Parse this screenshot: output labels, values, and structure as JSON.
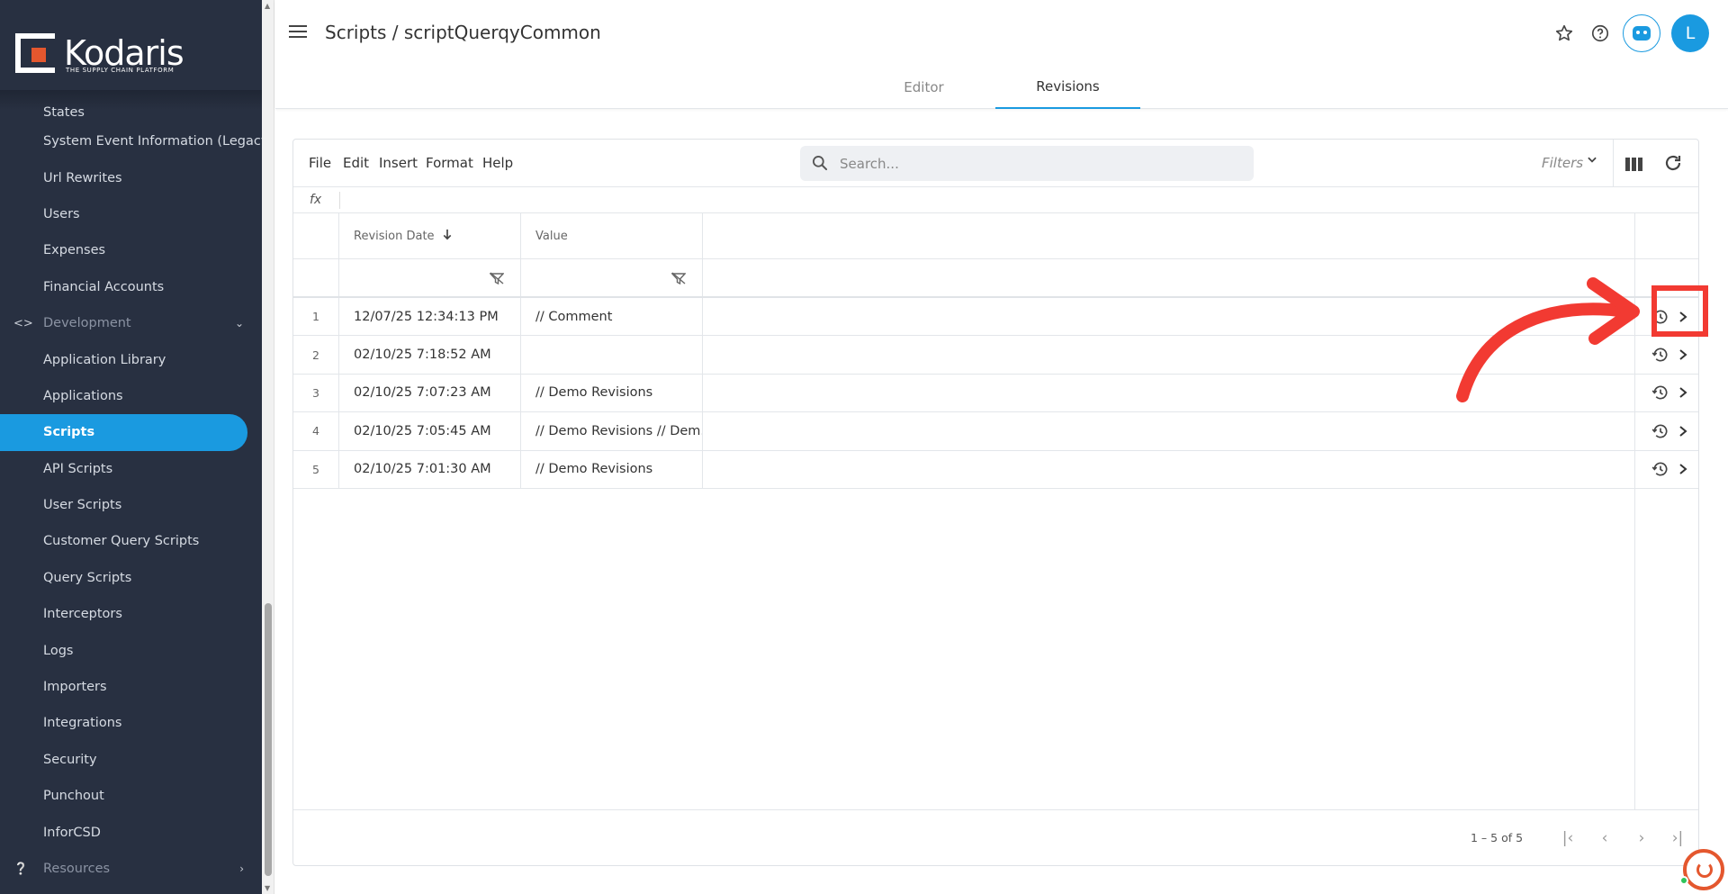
{
  "sidebar": {
    "logo_text": "Kodaris",
    "logo_tagline": "THE SUPPLY CHAIN PLATFORM",
    "items": [
      {
        "label": "States"
      },
      {
        "label": "System Event Information (Legacy)"
      },
      {
        "label": "Url Rewrites"
      },
      {
        "label": "Users"
      },
      {
        "label": "Expenses"
      },
      {
        "label": "Financial Accounts"
      },
      {
        "label": "Development"
      },
      {
        "label": "Application Library"
      },
      {
        "label": "Applications"
      },
      {
        "label": "Scripts"
      },
      {
        "label": "API Scripts"
      },
      {
        "label": "User Scripts"
      },
      {
        "label": "Customer Query Scripts"
      },
      {
        "label": "Query Scripts"
      },
      {
        "label": "Interceptors"
      },
      {
        "label": "Logs"
      },
      {
        "label": "Importers"
      },
      {
        "label": "Integrations"
      },
      {
        "label": "Security"
      },
      {
        "label": "Punchout"
      },
      {
        "label": "InforCSD"
      },
      {
        "label": "Resources"
      }
    ],
    "active_item": "Scripts",
    "accent": "#1a9ae0",
    "background": "#283041"
  },
  "header": {
    "title": "Scripts / scriptQuerqyCommon",
    "avatar_initial": "L",
    "tabs": [
      {
        "label": "Editor"
      },
      {
        "label": "Revisions"
      }
    ],
    "active_tab": "Revisions"
  },
  "toolbar": {
    "menus": [
      "File",
      "Edit",
      "Insert",
      "Format",
      "Help"
    ],
    "search_placeholder": "Search...",
    "filters_label": "Filters",
    "formula_label": "fx"
  },
  "table": {
    "columns": [
      "Revision Date",
      "Value"
    ],
    "sort_column": "Revision Date",
    "sort_direction": "descending",
    "rows": [
      {
        "num": "1",
        "date": "12/07/25 12:34:13 PM",
        "value": "// Comment"
      },
      {
        "num": "2",
        "date": "02/10/25 7:18:52 AM",
        "value": ""
      },
      {
        "num": "3",
        "date": "02/10/25 7:07:23 AM",
        "value": "// Demo Revisions"
      },
      {
        "num": "4",
        "date": "02/10/25 7:05:45 AM",
        "value": "// Demo Revisions // Dem..."
      },
      {
        "num": "5",
        "date": "02/10/25 7:01:30 AM",
        "value": "// Demo Revisions"
      }
    ]
  },
  "pagination": {
    "info": "1 – 5 of 5"
  },
  "annotation": {
    "color": "#f23a32",
    "target": "row-1-open-chevron"
  }
}
